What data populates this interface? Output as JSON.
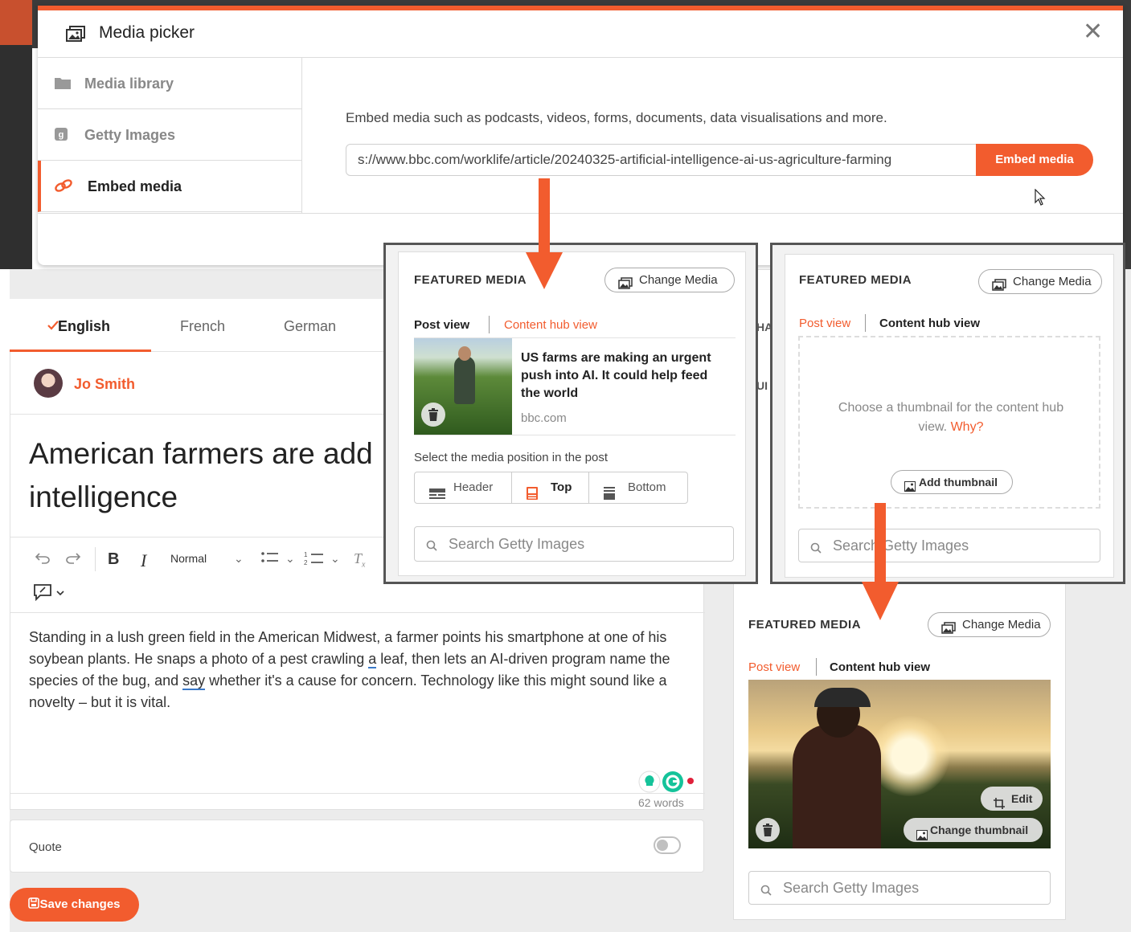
{
  "colors": {
    "accent": "#f25c2e",
    "text_dark": "#222222",
    "muted": "#888888"
  },
  "modal": {
    "title": "Media picker",
    "close": "✕",
    "sidebar": [
      {
        "label": "Media library",
        "icon": "folder-icon"
      },
      {
        "label": "Getty Images",
        "icon": "getty-icon"
      },
      {
        "label": "Embed media",
        "icon": "link-icon",
        "active": true
      }
    ],
    "description": "Embed media such as podcasts, videos, forms, documents, data visualisations and more.",
    "url_value": "s://www.bbc.com/worklife/article/20240325-artificial-intelligence-ai-us-agriculture-farming",
    "embed_button": "Embed media"
  },
  "background_panel": {
    "partial_1": "HA",
    "partial_2": "UI"
  },
  "editor": {
    "tabs": [
      {
        "label": "English",
        "active": true
      },
      {
        "label": "French"
      },
      {
        "label": "German"
      }
    ],
    "author": "Jo Smith",
    "title": "American farmers are add intelligence",
    "toolbar": {
      "style": "Normal"
    },
    "body": {
      "p1": "Standing in a lush green field in the American Midwest, a farmer points his smartphone at one of his soybean plants. He snaps a photo of a pest crawling ",
      "u1": "a",
      "p2": " leaf, then lets an AI-driven program name the species of the bug, and ",
      "u2": "say",
      "p3": " whether it's a cause for concern. Technology like this might sound like a novelty – but it is vital."
    },
    "word_count": "62 words",
    "quote_label": "Quote",
    "save_button": "Save changes"
  },
  "featured_post_view": {
    "title": "FEATURED MEDIA",
    "change_media": "Change Media",
    "tab_post": "Post view",
    "tab_hub": "Content hub view",
    "headline": "US farms are making an urgent push into AI. It could help feed the world",
    "source": "bbc.com",
    "position_label": "Select the media position in the post",
    "positions": [
      "Header",
      "Top",
      "Bottom"
    ],
    "search_placeholder": "Search Getty Images"
  },
  "featured_hub_empty": {
    "title": "FEATURED MEDIA",
    "change_media": "Change Media",
    "tab_post": "Post view",
    "tab_hub": "Content hub view",
    "drop_text": "Choose a thumbnail for the content hub view.",
    "why": "Why?",
    "add_thumbnail": "Add thumbnail",
    "search_placeholder": "Search Getty Images"
  },
  "featured_hub_set": {
    "title": "FEATURED MEDIA",
    "change_media": "Change Media",
    "tab_post": "Post view",
    "tab_hub": "Content hub view",
    "edit": "Edit",
    "change_thumbnail": "Change thumbnail",
    "search_placeholder": "Search Getty Images"
  }
}
